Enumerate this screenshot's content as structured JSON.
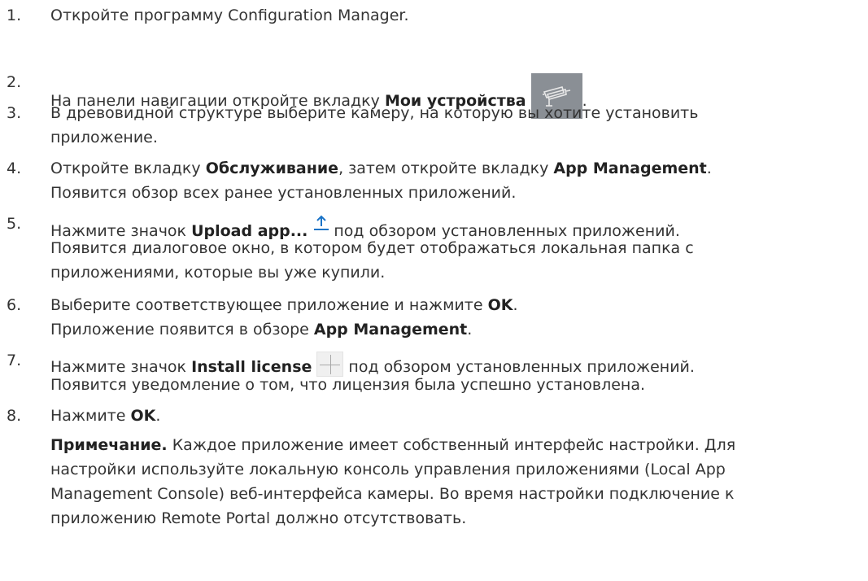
{
  "steps": [
    {
      "num": "1.",
      "l1": "Откройте программу Configuration Manager."
    },
    {
      "num": "2.",
      "l1_pre": "На панели навигации откройте вкладку ",
      "l1_bold": "Мои устройства",
      "l1_post": "."
    },
    {
      "num": "3.",
      "l1": "В древовидной структуре выберите камеру, на которую вы хотите установить",
      "l2": "приложение."
    },
    {
      "num": "4.",
      "l1_a": "Откройте вкладку ",
      "l1_b": "Обслуживание",
      "l1_c": ", затем откройте вкладку ",
      "l1_d": "App Management",
      "l1_e": ".",
      "l2": "Появится обзор всех ранее установленных приложений."
    },
    {
      "num": "5.",
      "l1_pre": "Нажмите значок ",
      "l1_bold": "Upload app...",
      "l1_post": "под обзором установленных приложений.",
      "l2": "Появится диалоговое окно, в котором будет отображаться локальная папка с",
      "l3": "приложениями, которые вы уже купили."
    },
    {
      "num": "6.",
      "l1_pre": "Выберите соответствующее приложение и нажмите ",
      "l1_bold": "OK",
      "l1_post": ".",
      "l2_pre": "Приложение появится в обзоре ",
      "l2_bold": "App Management",
      "l2_post": "."
    },
    {
      "num": "7.",
      "l1_pre": "Нажмите значок ",
      "l1_bold": "Install license",
      "l1_post": "под обзором установленных приложений.",
      "l2": "Появится уведомление о том, что лицензия была успешно установлена."
    },
    {
      "num": "8.",
      "l1_pre": "Нажмите ",
      "l1_bold": "OK",
      "l1_post": ".",
      "note_bold": "Примечание.",
      "note_l1": " Каждое приложение имеет собственный интерфейс настройки. Для",
      "note_l2": "настройки используйте локальную консоль управления приложениями (Local App",
      "note_l3": "Management Console) веб-интерфейса камеры. Во время настройки подключение к",
      "note_l4": "приложению Remote Portal должно отсутствовать."
    }
  ],
  "icons": {
    "camera": "camera-icon",
    "upload": "upload-icon",
    "plus": "plus-icon",
    "accent": "#1a73c7"
  }
}
